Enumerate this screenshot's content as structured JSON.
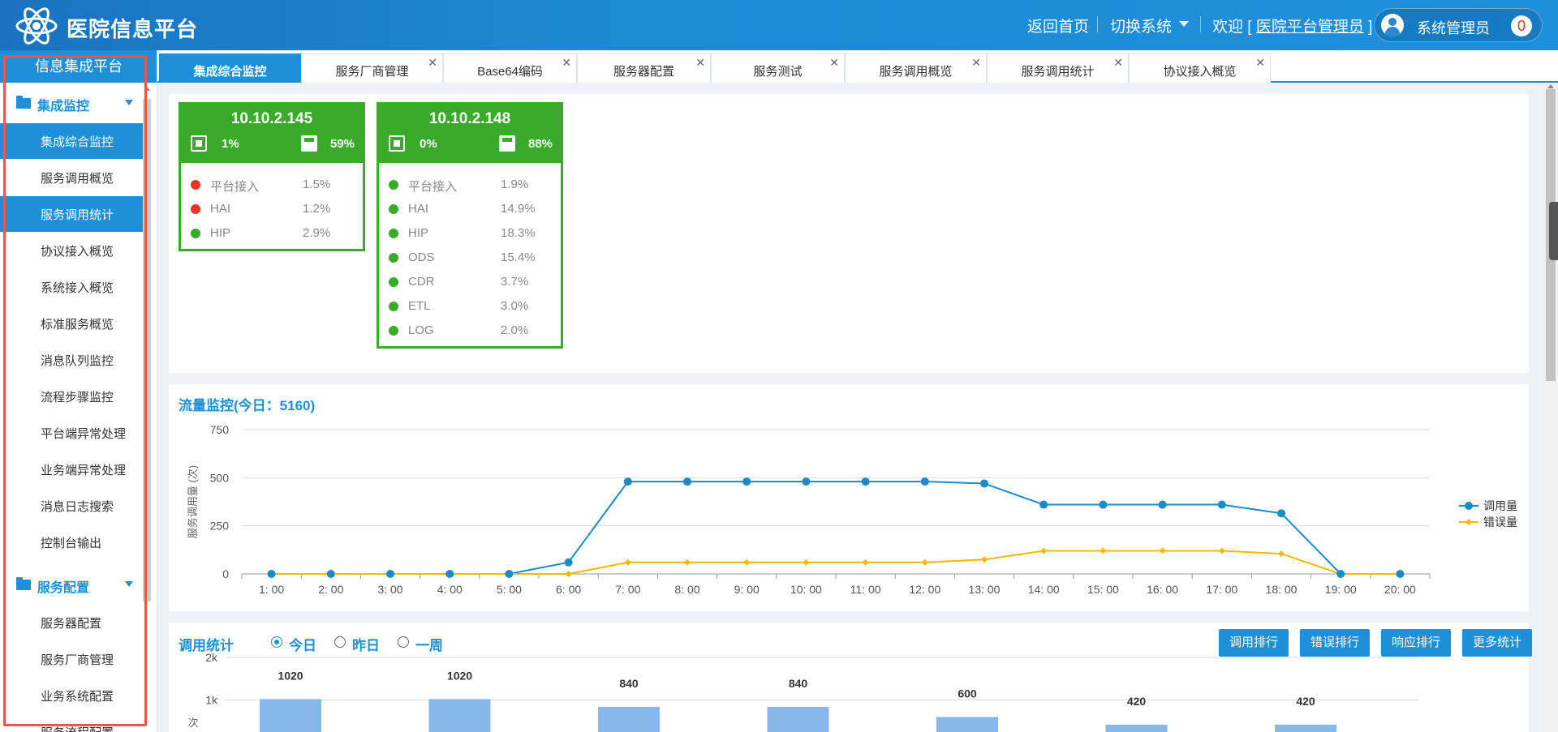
{
  "app": {
    "title": "医院信息平台"
  },
  "header": {
    "home_label": "返回首页",
    "switch_label": "切换系统",
    "welcome_prefix": "欢迎 [ ",
    "welcome_user": "医院平台管理员",
    "welcome_suffix": " ]",
    "user_name": "系统管理员",
    "notification_count": "0"
  },
  "sidebar": {
    "title": "信息集成平台",
    "groups": [
      {
        "label": "集成监控",
        "items": [
          {
            "label": "集成综合监控",
            "active": true
          },
          {
            "label": "服务调用概览",
            "active": false
          },
          {
            "label": "服务调用统计",
            "active": true
          },
          {
            "label": "协议接入概览",
            "active": false
          },
          {
            "label": "系统接入概览",
            "active": false
          },
          {
            "label": "标准服务概览",
            "active": false
          },
          {
            "label": "消息队列监控",
            "active": false
          },
          {
            "label": "流程步骤监控",
            "active": false
          },
          {
            "label": "平台端异常处理",
            "active": false
          },
          {
            "label": "业务端异常处理",
            "active": false
          },
          {
            "label": "消息日志搜索",
            "active": false
          },
          {
            "label": "控制台输出",
            "active": false
          }
        ]
      },
      {
        "label": "服务配置",
        "items": [
          {
            "label": "服务器配置",
            "active": false
          },
          {
            "label": "服务厂商管理",
            "active": false
          },
          {
            "label": "业务系统配置",
            "active": false
          },
          {
            "label": "服务流程配置",
            "active": false
          }
        ]
      }
    ]
  },
  "tabs": [
    {
      "label": "集成综合监控",
      "active": true,
      "closable": false
    },
    {
      "label": "服务厂商管理",
      "active": false,
      "closable": true
    },
    {
      "label": "Base64编码",
      "active": false,
      "closable": true
    },
    {
      "label": "服务器配置",
      "active": false,
      "closable": true
    },
    {
      "label": "服务测试",
      "active": false,
      "closable": true
    },
    {
      "label": "服务调用概览",
      "active": false,
      "closable": true
    },
    {
      "label": "服务调用统计",
      "active": false,
      "closable": true
    },
    {
      "label": "协议接入概览",
      "active": false,
      "closable": true
    }
  ],
  "servers": [
    {
      "ip": "10.10.2.145",
      "cpu": "1%",
      "disk": "59%",
      "services": [
        {
          "name": "平台接入",
          "percent": "1.5%",
          "status": "error"
        },
        {
          "name": "HAI",
          "percent": "1.2%",
          "status": "error"
        },
        {
          "name": "HIP",
          "percent": "2.9%",
          "status": "ok"
        }
      ]
    },
    {
      "ip": "10.10.2.148",
      "cpu": "0%",
      "disk": "88%",
      "services": [
        {
          "name": "平台接入",
          "percent": "1.9%",
          "status": "ok"
        },
        {
          "name": "HAI",
          "percent": "14.9%",
          "status": "ok"
        },
        {
          "name": "HIP",
          "percent": "18.3%",
          "status": "ok"
        },
        {
          "name": "ODS",
          "percent": "15.4%",
          "status": "ok"
        },
        {
          "name": "CDR",
          "percent": "3.7%",
          "status": "ok"
        },
        {
          "name": "ETL",
          "percent": "3.0%",
          "status": "ok"
        },
        {
          "name": "LOG",
          "percent": "2.0%",
          "status": "ok"
        }
      ]
    }
  ],
  "colors": {
    "accent": "#1e8fd8",
    "ok": "#3aaa2a",
    "error": "#ee3322",
    "call_series": "#1a8ac8",
    "error_series": "#f5b800",
    "bar": "#86b8ea"
  },
  "flow": {
    "title": "流量监控(今日：5160)"
  },
  "stats": {
    "title": "调用统计",
    "ranges": [
      {
        "label": "今日",
        "selected": true
      },
      {
        "label": "昨日",
        "selected": false
      },
      {
        "label": "一周",
        "selected": false
      }
    ],
    "buttons": [
      "调用排行",
      "错误排行",
      "响应排行",
      "更多统计"
    ]
  },
  "chart_data": [
    {
      "type": "line",
      "title": "流量监控(今日：5160)",
      "ylabel": "服务调用量 (次)",
      "ylim": [
        0,
        750
      ],
      "yticks": [
        0,
        250,
        500,
        750
      ],
      "grid": true,
      "legend": "right",
      "categories": [
        "1: 00",
        "2: 00",
        "3: 00",
        "4: 00",
        "5: 00",
        "6: 00",
        "7: 00",
        "8: 00",
        "9: 00",
        "10: 00",
        "11: 00",
        "12: 00",
        "13: 00",
        "14: 00",
        "15: 00",
        "16: 00",
        "17: 00",
        "18: 00",
        "19: 00",
        "20: 00"
      ],
      "series": [
        {
          "name": "调用量",
          "values": [
            0,
            0,
            0,
            0,
            0,
            60,
            480,
            480,
            480,
            480,
            480,
            480,
            470,
            360,
            360,
            360,
            360,
            315,
            0,
            0
          ]
        },
        {
          "name": "错误量",
          "values": [
            0,
            0,
            0,
            0,
            0,
            0,
            60,
            60,
            60,
            60,
            60,
            60,
            75,
            120,
            120,
            120,
            120,
            105,
            0,
            0
          ]
        }
      ]
    },
    {
      "type": "bar",
      "ylabel": "次",
      "ylim": [
        0,
        2000
      ],
      "yticks": [
        [
          "1k",
          1000
        ],
        [
          "2k",
          2000
        ]
      ],
      "grid": true,
      "values": [
        1020,
        1020,
        840,
        840,
        600,
        420,
        420
      ]
    }
  ]
}
